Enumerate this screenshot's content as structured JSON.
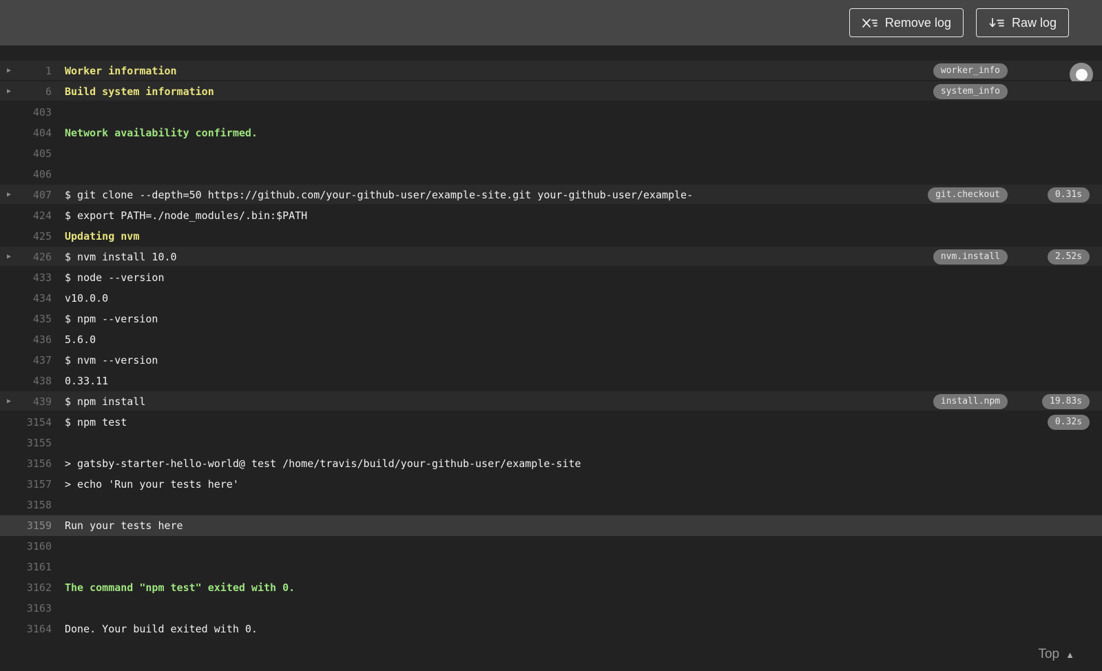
{
  "toolbar": {
    "remove_log_label": "Remove log",
    "raw_log_label": "Raw log"
  },
  "footer": {
    "top_label": "Top"
  },
  "icons": {
    "remove_log": "x-with-list-lines-icon",
    "raw_log": "down-arrow-with-list-lines-icon",
    "fold_arrow": "right-triangle-fold-icon",
    "caret_up": "caret-up-icon",
    "scroll_knob": "round-scroll-knob"
  },
  "colors": {
    "toolbar_bg": "#464646",
    "log_bg": "#222222",
    "fold_row_bg": "#2b2b2b",
    "highlight_row_bg": "#3a3a3a",
    "text": "#f1f1f1",
    "line_number": "#6e6e6e",
    "yellow": "#e9e47e",
    "green": "#9fe57f",
    "badge_bg": "#767676",
    "badge_text": "#e9e9e9",
    "button_text": "#f2f2f2"
  },
  "log": {
    "rows": [
      {
        "n": "1",
        "text": "Worker information",
        "color": "yellow",
        "fold": true,
        "bg": "fold-bg",
        "tag": "worker_info",
        "knob": true
      },
      {
        "n": "6",
        "text": "Build system information",
        "color": "yellow",
        "fold": true,
        "bg": "fold-bg",
        "tag": "system_info"
      },
      {
        "n": "403",
        "text": ""
      },
      {
        "n": "404",
        "text": "Network availability confirmed.",
        "color": "green"
      },
      {
        "n": "405",
        "text": ""
      },
      {
        "n": "406",
        "text": ""
      },
      {
        "n": "407",
        "text": "$ git clone --depth=50 https://github.com/your-github-user/example-site.git your-github-user/example-",
        "fold": true,
        "bg": "fold-bg",
        "tag": "git.checkout",
        "duration": "0.31s"
      },
      {
        "n": "424",
        "text": "$ export PATH=./node_modules/.bin:$PATH"
      },
      {
        "n": "425",
        "text": "Updating nvm",
        "color": "yellow"
      },
      {
        "n": "426",
        "text": "$ nvm install 10.0",
        "fold": true,
        "bg": "fold-bg",
        "tag": "nvm.install",
        "duration": "2.52s"
      },
      {
        "n": "433",
        "text": "$ node --version"
      },
      {
        "n": "434",
        "text": "v10.0.0"
      },
      {
        "n": "435",
        "text": "$ npm --version"
      },
      {
        "n": "436",
        "text": "5.6.0"
      },
      {
        "n": "437",
        "text": "$ nvm --version"
      },
      {
        "n": "438",
        "text": "0.33.11"
      },
      {
        "n": "439",
        "text": "$ npm install",
        "fold": true,
        "bg": "fold-bg",
        "tag": "install.npm",
        "duration": "19.83s"
      },
      {
        "n": "3154",
        "text": "$ npm test",
        "duration": "0.32s"
      },
      {
        "n": "3155",
        "text": ""
      },
      {
        "n": "3156",
        "text": "> gatsby-starter-hello-world@ test /home/travis/build/your-github-user/example-site"
      },
      {
        "n": "3157",
        "text": "> echo 'Run your tests here'"
      },
      {
        "n": "3158",
        "text": ""
      },
      {
        "n": "3159",
        "text": "Run your tests here",
        "bg": "highlight"
      },
      {
        "n": "3160",
        "text": ""
      },
      {
        "n": "3161",
        "text": ""
      },
      {
        "n": "3162",
        "text": "The command \"npm test\" exited with 0.",
        "color": "green"
      },
      {
        "n": "3163",
        "text": ""
      },
      {
        "n": "3164",
        "text": "Done. Your build exited with 0."
      }
    ]
  }
}
